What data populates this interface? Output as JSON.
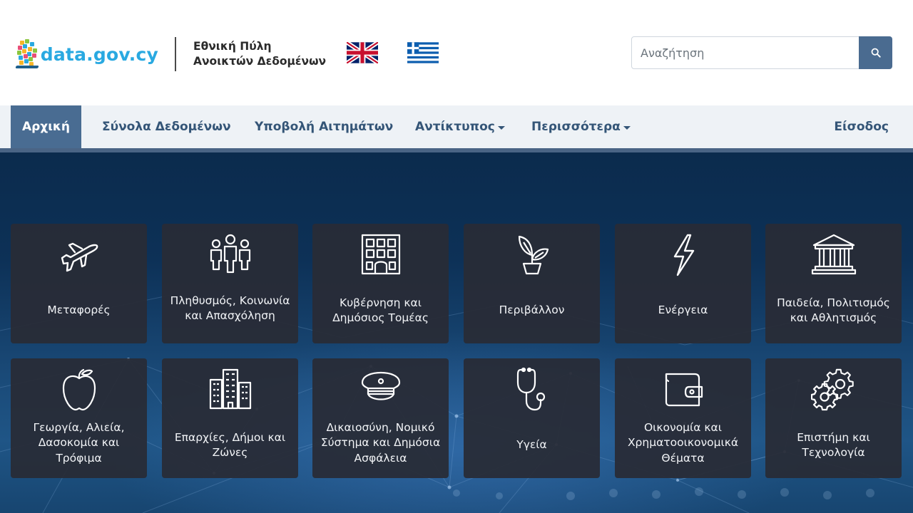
{
  "header": {
    "logo_text": "data.gov.cy",
    "portal_title_line1": "Εθνική Πύλη",
    "portal_title_line2": "Ανοικτών Δεδομένων",
    "language_flags": [
      "uk-flag-icon",
      "greece-flag-icon"
    ],
    "search": {
      "placeholder": "Αναζήτηση",
      "value": "",
      "button_icon": "search-icon"
    }
  },
  "nav": {
    "items": [
      {
        "label": "Αρχική",
        "active": true
      },
      {
        "label": "Σύνολα Δεδομένων"
      },
      {
        "label": "Υποβολή Αιτημάτων"
      },
      {
        "label": "Αντίκτυπος",
        "dropdown": true
      },
      {
        "label": "Περισσότερα",
        "dropdown": true
      }
    ],
    "login_label": "Είσοδος"
  },
  "categories": [
    {
      "label": "Μεταφορές",
      "icon": "airplane-icon"
    },
    {
      "label": "Πληθυσμός, Κοινωνία και Απασχόληση",
      "icon": "people-icon"
    },
    {
      "label": "Κυβέρνηση και Δημόσιος Τομέας",
      "icon": "building-icon"
    },
    {
      "label": "Περιβάλλον",
      "icon": "plant-icon"
    },
    {
      "label": "Ενέργεια",
      "icon": "lightning-icon"
    },
    {
      "label": "Παιδεία, Πολιτισμός και Αθλητισμός",
      "icon": "museum-icon"
    },
    {
      "label": "Γεωργία, Αλιεία, Δασοκομία και Τρόφιμα",
      "icon": "apple-icon"
    },
    {
      "label": "Επαρχίες, Δήμοι και Ζώνες",
      "icon": "city-icon"
    },
    {
      "label": "Δικαιοσύνη, Νομικό Σύστημα και Δημόσια Ασφάλεια",
      "icon": "police-cap-icon"
    },
    {
      "label": "Υγεία",
      "icon": "stethoscope-icon"
    },
    {
      "label": "Οικονομία και Χρηματοοικονομικά Θέματα",
      "icon": "wallet-icon"
    },
    {
      "label": "Επιστήμη και Τεχνολογία",
      "icon": "gears-icon"
    }
  ],
  "colors": {
    "brand_blue": "#29a9e1",
    "nav_text": "#345577",
    "nav_active_bg": "#496c92",
    "tile_bg": "#282c36",
    "hero_bg": "#0d3157"
  }
}
